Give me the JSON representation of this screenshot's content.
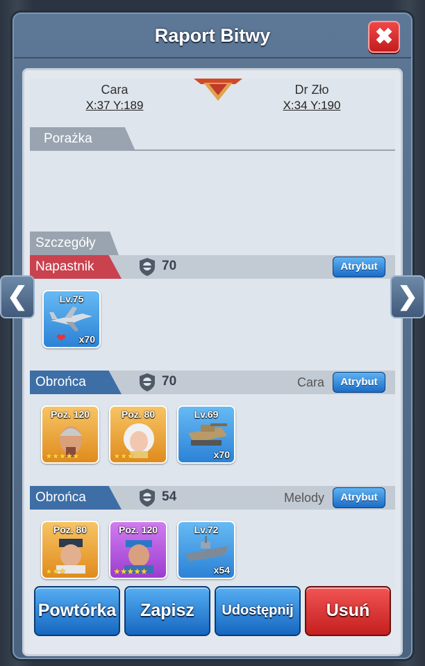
{
  "window": {
    "title": "Raport Bitwy"
  },
  "players": {
    "left": {
      "name": "Cara",
      "coords": "X:37 Y:189"
    },
    "right": {
      "name": "Dr Zło",
      "coords": "X:34 Y:190"
    }
  },
  "result": {
    "label": "Porażka"
  },
  "details": {
    "label": "Szczegóły"
  },
  "attacker": {
    "label": "Napastnik",
    "power": "70",
    "attr_label": "Atrybut",
    "units": [
      {
        "level": "Lv.75",
        "count": "x70",
        "icon": "jet-icon"
      }
    ]
  },
  "defenders": [
    {
      "label": "Obrońca",
      "power": "70",
      "owner": "Cara",
      "attr_label": "Atrybut",
      "units": [
        {
          "level": "Poz. 120",
          "stars": "★★★★★",
          "icon": "hero-old-man-icon"
        },
        {
          "level": "Poz. 80",
          "stars": "★★★",
          "icon": "hero-woman-icon"
        },
        {
          "level": "Lv.69",
          "count": "x70",
          "icon": "tank-icon"
        }
      ]
    },
    {
      "label": "Obrońca",
      "power": "54",
      "owner": "Melody",
      "attr_label": "Atrybut",
      "units": [
        {
          "level": "Poz. 80",
          "stars": "★★★",
          "icon": "hero-captain-icon"
        },
        {
          "level": "Poz. 120",
          "stars": "★★★★★",
          "icon": "hero-pirate-icon"
        },
        {
          "level": "Lv.72",
          "count": "x54",
          "icon": "warship-icon"
        }
      ]
    }
  ],
  "actions": {
    "replay": "Powtórka",
    "save": "Zapisz",
    "share": "Udostępnij",
    "delete": "Usuń"
  },
  "colors": {
    "attacker": "#c9424e",
    "defender": "#3d6ea6",
    "button_blue": "#1a6cc7",
    "button_red": "#c41f1f"
  }
}
